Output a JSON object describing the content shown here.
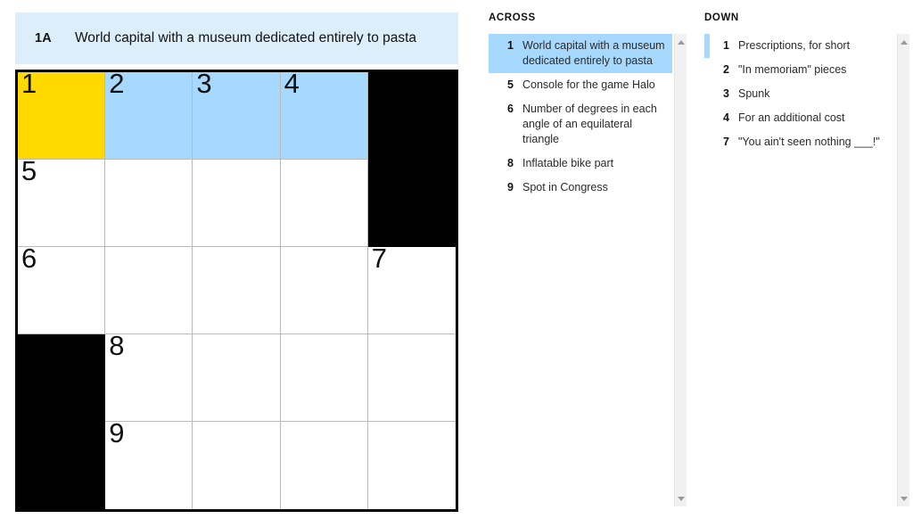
{
  "colors": {
    "cursor": "#FFD900",
    "highlight": "#A7D8FD",
    "clue_bar_bg": "#DCEEFA",
    "block": "#000000",
    "grid_line": "#B9B9B9"
  },
  "clue_bar": {
    "number": "1A",
    "text": "World capital with a museum dedicated entirely to pasta"
  },
  "grid": {
    "rows": 5,
    "cols": 5,
    "cells": [
      {
        "number": "1",
        "state": "cursor",
        "letter": ""
      },
      {
        "number": "2",
        "state": "highlight",
        "letter": ""
      },
      {
        "number": "3",
        "state": "highlight",
        "letter": ""
      },
      {
        "number": "4",
        "state": "highlight",
        "letter": ""
      },
      {
        "number": "",
        "state": "black",
        "letter": ""
      },
      {
        "number": "5",
        "state": "empty",
        "letter": ""
      },
      {
        "number": "",
        "state": "empty",
        "letter": ""
      },
      {
        "number": "",
        "state": "empty",
        "letter": ""
      },
      {
        "number": "",
        "state": "empty",
        "letter": ""
      },
      {
        "number": "",
        "state": "black",
        "letter": ""
      },
      {
        "number": "6",
        "state": "empty",
        "letter": ""
      },
      {
        "number": "",
        "state": "empty",
        "letter": ""
      },
      {
        "number": "",
        "state": "empty",
        "letter": ""
      },
      {
        "number": "",
        "state": "empty",
        "letter": ""
      },
      {
        "number": "7",
        "state": "empty",
        "letter": ""
      },
      {
        "number": "",
        "state": "black",
        "letter": ""
      },
      {
        "number": "8",
        "state": "empty",
        "letter": ""
      },
      {
        "number": "",
        "state": "empty",
        "letter": ""
      },
      {
        "number": "",
        "state": "empty",
        "letter": ""
      },
      {
        "number": "",
        "state": "empty",
        "letter": ""
      },
      {
        "number": "",
        "state": "black",
        "letter": ""
      },
      {
        "number": "9",
        "state": "empty",
        "letter": ""
      },
      {
        "number": "",
        "state": "empty",
        "letter": ""
      },
      {
        "number": "",
        "state": "empty",
        "letter": ""
      },
      {
        "number": "",
        "state": "empty",
        "letter": ""
      }
    ]
  },
  "across": {
    "heading": "ACROSS",
    "clues": [
      {
        "number": "1",
        "text": "World capital with a museum dedicated entirely to pasta",
        "selected": true,
        "marked": false
      },
      {
        "number": "5",
        "text": "Console for the game Halo",
        "selected": false,
        "marked": false
      },
      {
        "number": "6",
        "text": "Number of degrees in each angle of an equilateral triangle",
        "selected": false,
        "marked": false
      },
      {
        "number": "8",
        "text": "Inflatable bike part",
        "selected": false,
        "marked": false
      },
      {
        "number": "9",
        "text": "Spot in Congress",
        "selected": false,
        "marked": false
      }
    ]
  },
  "down": {
    "heading": "DOWN",
    "clues": [
      {
        "number": "1",
        "text": "Prescriptions, for short",
        "selected": false,
        "marked": true
      },
      {
        "number": "2",
        "text": "\"In memoriam\" pieces",
        "selected": false,
        "marked": false
      },
      {
        "number": "3",
        "text": "Spunk",
        "selected": false,
        "marked": false
      },
      {
        "number": "4",
        "text": "For an additional cost",
        "selected": false,
        "marked": false
      },
      {
        "number": "7",
        "text": "\"You ain't seen nothing ___!\"",
        "selected": false,
        "marked": false
      }
    ]
  },
  "scrollbars": {
    "up_arrow": "triangle-up-icon",
    "down_arrow": "triangle-down-icon"
  }
}
